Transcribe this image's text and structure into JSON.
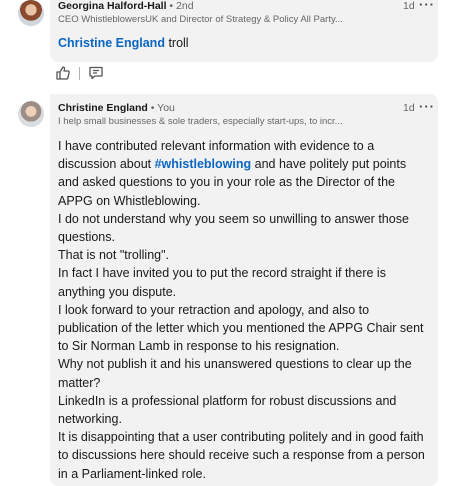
{
  "comment1": {
    "author": "Georgina Halford-Hall",
    "degree": "2nd",
    "headline": "CEO WhistleblowersUK and Director of Strategy & Policy All Party...",
    "time": "1d",
    "mention": "Christine England",
    "text_after_mention": "troll",
    "actions": {
      "like_icon": "thumbs-up-icon",
      "reply_icon": "comment-icon"
    }
  },
  "comment2": {
    "author": "Christine England",
    "badge": "You",
    "headline": "I help small businesses & sole traders, especially start-ups, to incr...",
    "time": "1d",
    "paragraphs": [
      {
        "before": "I have contributed relevant information with evidence to a discussion about ",
        "hashtag": "#whistleblowing",
        "after": " and have politely put points and asked questions to you in your role as the Director of the APPG on Whistleblowing."
      },
      {
        "text": "I do not understand why you seem so unwilling to answer those questions."
      },
      {
        "text": "That is not \"trolling\"."
      },
      {
        "text": "In fact I have invited you to put the record straight if there is anything you dispute."
      },
      {
        "text": "I look forward to your retraction and apology, and also to publication of the letter which you mentioned the APPG Chair sent to Sir Norman Lamb in response to his resignation."
      },
      {
        "text": "Why not publish it and his unanswered questions to clear up the matter?"
      },
      {
        "text": "LinkedIn is a professional platform for robust discussions and networking."
      },
      {
        "text": "It is disappointing that a user contributing politely and in good faith to discussions here should receive such a response from a person in a Parliament-linked role."
      }
    ]
  }
}
